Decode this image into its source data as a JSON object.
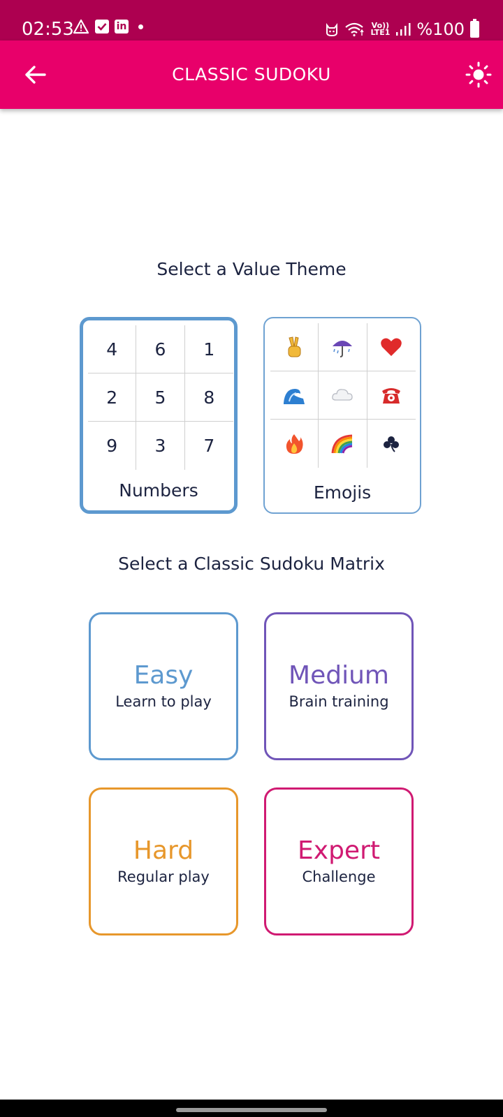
{
  "status_bar": {
    "time": "02:53",
    "battery_text": "%100",
    "network_label_top": "Vo))",
    "network_label_bottom": "LTE1",
    "linkedin_label": "in",
    "icons": [
      "warning-icon",
      "check-box-icon",
      "linkedin-icon",
      "dot-icon",
      "cat-icon",
      "wifi-icon",
      "signal-icon",
      "battery-icon"
    ]
  },
  "app_bar": {
    "title": "CLASSIC SUDOKU",
    "back_icon": "arrow-left-icon",
    "theme_icon": "sun-icon"
  },
  "value_theme": {
    "heading": "Select a Value Theme",
    "options": [
      {
        "label": "Numbers",
        "selected": true,
        "cells": [
          "4",
          "6",
          "1",
          "2",
          "5",
          "8",
          "9",
          "3",
          "7"
        ]
      },
      {
        "label": "Emojis",
        "selected": false,
        "cells": [
          "victory-hand-emoji",
          "umbrella-emoji",
          "red-heart-emoji",
          "water-wave-emoji",
          "cloud-emoji",
          "telephone-emoji",
          "fire-emoji",
          "rainbow-emoji",
          "shamrock-emoji"
        ]
      }
    ]
  },
  "matrix": {
    "heading": "Select a Classic Sudoku Matrix",
    "levels": [
      {
        "name": "Easy",
        "subtitle": "Learn to play",
        "color": "#5d99cf"
      },
      {
        "name": "Medium",
        "subtitle": "Brain training",
        "color": "#7055b8"
      },
      {
        "name": "Hard",
        "subtitle": "Regular play",
        "color": "#e7972b"
      },
      {
        "name": "Expert",
        "subtitle": "Challenge",
        "color": "#d01a72"
      }
    ]
  },
  "colors": {
    "status_bar": "#ad0050",
    "app_bar": "#e8006a",
    "selected_border": "#5d99cf"
  }
}
